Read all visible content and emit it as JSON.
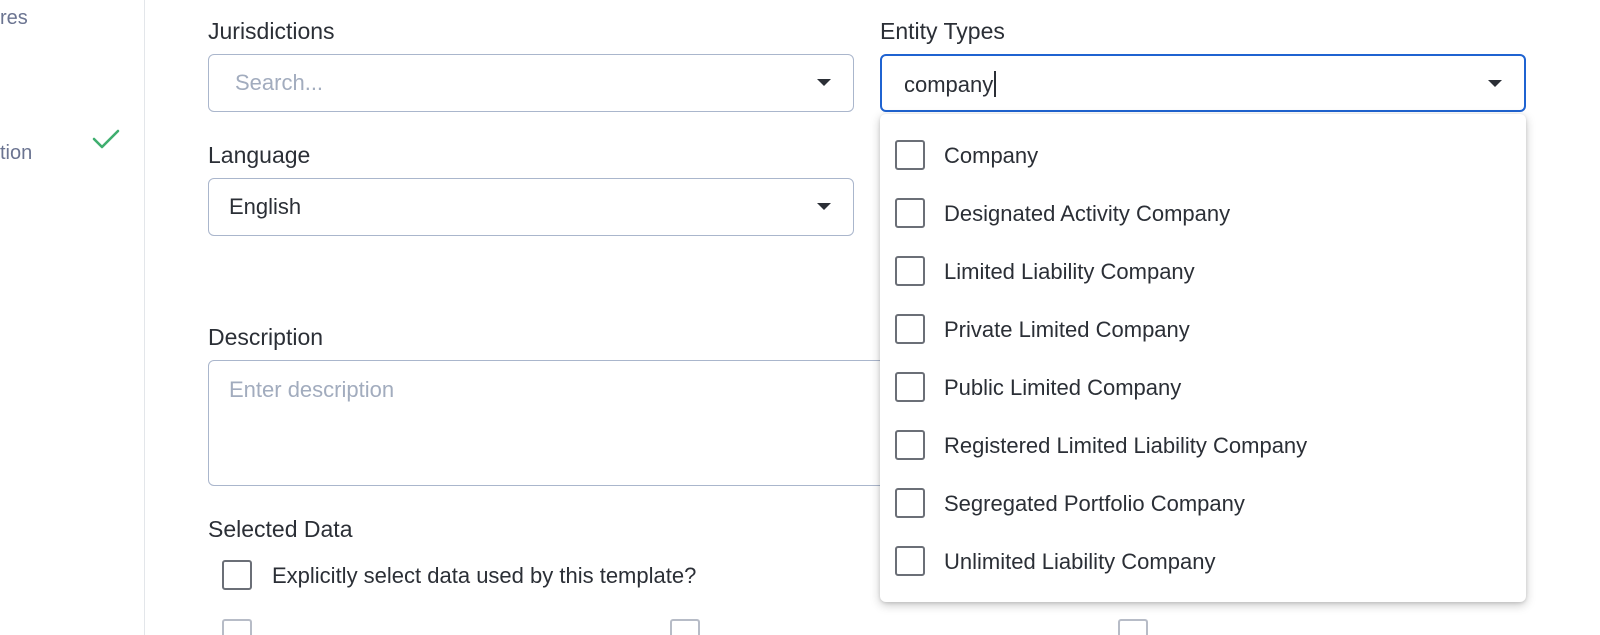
{
  "sidebar": {
    "items": [
      {
        "label": "res"
      },
      {
        "label": "tion"
      }
    ]
  },
  "form": {
    "jurisdictions": {
      "label": "Jurisdictions",
      "placeholder": "Search..."
    },
    "entity_types": {
      "label": "Entity Types",
      "value": "company"
    },
    "language": {
      "label": "Language",
      "value": "English"
    },
    "description": {
      "label": "Description",
      "placeholder": "Enter description"
    },
    "selected_data": {
      "label": "Selected Data",
      "explicit_checkbox_label": "Explicitly select data used by this template?"
    }
  },
  "dropdown": {
    "options": [
      {
        "label": "Company"
      },
      {
        "label": "Designated Activity Company"
      },
      {
        "label": "Limited Liability Company"
      },
      {
        "label": "Private Limited Company"
      },
      {
        "label": "Public Limited Company"
      },
      {
        "label": "Registered Limited Liability Company"
      },
      {
        "label": "Segregated Portfolio Company"
      },
      {
        "label": "Unlimited Liability Company"
      }
    ]
  },
  "colors": {
    "accent": "#1f63d1",
    "check": "#3fae6f",
    "border": "#aab6cc"
  },
  "icons": [
    "check-icon",
    "chevron-down-icon"
  ]
}
